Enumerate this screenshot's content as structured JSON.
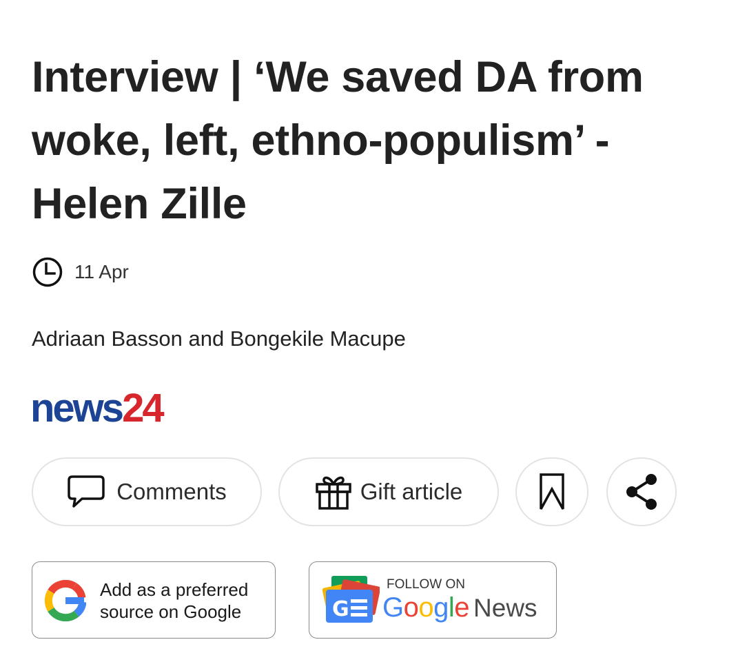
{
  "article": {
    "headline": "Interview | ‘We saved DA from woke, left, ethno-populism’ - Helen Zille",
    "date": "11 Apr",
    "byline": "Adriaan Basson and Bongekile Macupe"
  },
  "brand": {
    "logo_word": "news",
    "logo_number": "24",
    "colors": {
      "news": "#1d4494",
      "number": "#d7262c"
    }
  },
  "actions": {
    "comments_label": "Comments",
    "gift_label": "Gift article",
    "bookmark_icon": "bookmark-icon",
    "share_icon": "share-icon"
  },
  "badges": {
    "google_source_line1": "Add as a preferred",
    "google_source_line2": "source on Google",
    "gnews_follow": "FOLLOW ON",
    "gnews_google_letters": [
      "G",
      "o",
      "o",
      "g",
      "l",
      "e"
    ],
    "gnews_google_colors": [
      "#4285F4",
      "#EA4335",
      "#FBBC05",
      "#4285F4",
      "#34A853",
      "#EA4335"
    ],
    "gnews_news": "News"
  }
}
